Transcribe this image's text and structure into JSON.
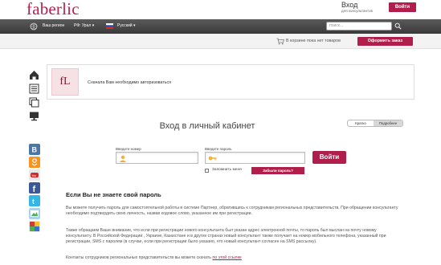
{
  "header": {
    "logo": "faberlic",
    "login_title": "Вход",
    "login_subtitle": "для консультантов",
    "login_button": "Войти"
  },
  "navbar": {
    "region": "Ваш регион",
    "region_value": "РФ: Урал",
    "language": "Русский",
    "search_placeholder": "поиск..."
  },
  "cart": {
    "status": "В корзине пока нет товаров",
    "order_button": "Оформить заказ"
  },
  "notice": {
    "logo_text": "fL",
    "message": "Сначала Вам необходимо авторизоваться"
  },
  "main": {
    "title": "Вход в личный кабинет",
    "toggle": {
      "left": "Кратко",
      "right": "Подробнее"
    },
    "form": {
      "login_label": "Введите номер",
      "password_label": "Введите пароль",
      "login_value": "",
      "password_value": "",
      "enter_button": "Войти",
      "remember_label": "Запомнить меня",
      "forgot_button": "Забыли пароль?"
    },
    "help": {
      "title": "Если Вы не знаете свой пароль",
      "p1": "Вы можете получить пароль для самостоятельной работы в системе Партнер, обратившись к сотрудникам региональных представительств. При обращении консультанту необходимо подтвердить свою личность, назвав кодовое слово, указанное им при регистрации.",
      "p2": "Также обращаем Ваше внимание, что если при регистрации нового консультанта был указан адрес электронной почты, то пароль был выслан на почту новому консультанту. В Российской Федерации , Украине, Казахстане и в других странах новый консультант также получает на номер мобильного телефона, указанный при регистрации, SMS с паролем (в случае, если при регистрации было указано, что новый консультант согласен на SMS рассылку).",
      "p3_text": "Контакты сотрудников региональных представительств вы можете скачать",
      "p3_link": "по этой ссылке"
    }
  },
  "colors": {
    "brand": "#b01f4c",
    "nav_bg": "#444444"
  }
}
